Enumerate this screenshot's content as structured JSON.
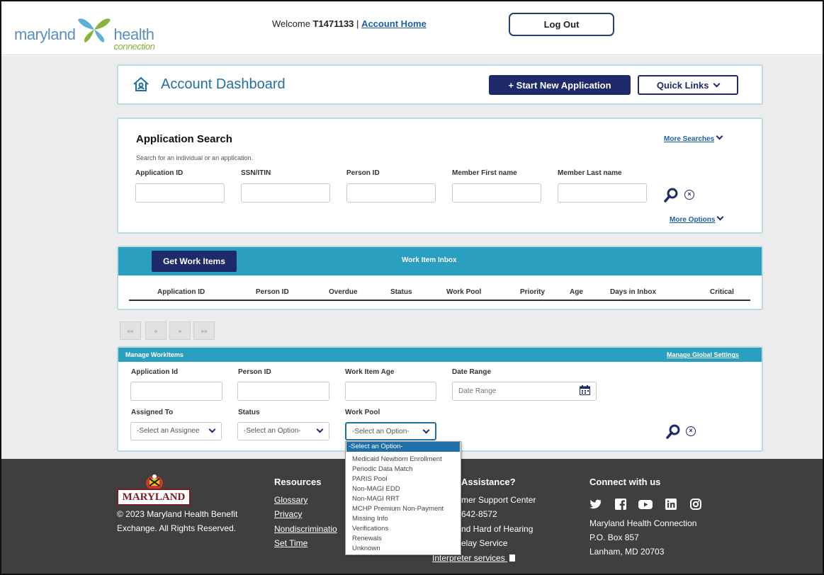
{
  "header": {
    "logo_word_1": "maryland",
    "logo_word_2": "health",
    "logo_word_3": "connection",
    "welcome_prefix": "Welcome",
    "user_id": "T1471133",
    "separator": "|",
    "account_home": "Account Home",
    "logout": "Log Out"
  },
  "dashboard": {
    "title": "Account Dashboard",
    "start_new": "+ Start New Application",
    "quick_links": "Quick Links"
  },
  "app_search": {
    "title": "Application Search",
    "subtitle": "Search for an individual or an application.",
    "more_searches": "More Searches",
    "more_options": "More Options",
    "fields": [
      {
        "label": "Application ID",
        "value": ""
      },
      {
        "label": "SSN/ITIN",
        "value": ""
      },
      {
        "label": "Person ID",
        "value": ""
      },
      {
        "label": "Member First name",
        "value": ""
      },
      {
        "label": "Member Last name",
        "value": ""
      }
    ]
  },
  "inbox": {
    "get_button": "Get Work Items",
    "title": "Work Item Inbox",
    "columns": [
      "Application ID",
      "Person ID",
      "Overdue",
      "Status",
      "Work Pool",
      "Priority",
      "Age",
      "Days in Inbox",
      "Critical"
    ]
  },
  "pager": [
    "««",
    "«",
    "»",
    "»»"
  ],
  "manage": {
    "title": "Manage WorkItems",
    "global_settings": "Manage Global Settings",
    "fields": [
      {
        "label": "Application Id",
        "value": ""
      },
      {
        "label": "Person ID",
        "value": ""
      },
      {
        "label": "Work Item Age",
        "value": ""
      },
      {
        "label": "Date Range",
        "placeholder": "Date Range"
      }
    ],
    "selects": [
      {
        "label": "Assigned To",
        "value": "-Select an Assignee"
      },
      {
        "label": "Status",
        "value": "-Select an Option-"
      },
      {
        "label": "Work Pool",
        "value": "-Select an Option-"
      }
    ],
    "workpool_options": [
      "-Select an Option-",
      "Medicaid Newborn Enrollment",
      "Periodic Data Match",
      "PARIS Pool",
      "Non-MAGI EDD",
      "Non-MAGI RRT",
      "MCHP Premium Non-Payment",
      "Missing Info",
      "Verifications",
      "Renewals",
      "Unknown"
    ]
  },
  "footer": {
    "maryland_badge": "MARYLAND",
    "copyright_1": "© 2023 Maryland Health Benefit",
    "copyright_2": "Exchange. All Rights Reserved.",
    "resources_title": "Resources",
    "resources": [
      "Glossary",
      "Privacy",
      "Nondiscriminatio",
      "Set Time"
    ],
    "assistance_title": "Assistance?",
    "assistance": [
      "mer Support Center",
      "642-8572",
      "nd Hard of Hearing",
      "elay Service"
    ],
    "interpreter": "Interpreter services",
    "connect_title": "Connect with us",
    "org": "Maryland Health Connection",
    "po_box": "P.O. Box 857",
    "city": "Lanham, MD 20703"
  },
  "colors": {
    "navy": "#1f2a6b",
    "teal": "#2a9fc0",
    "footer": "#3f3f3f",
    "link": "#1b5fa8"
  }
}
